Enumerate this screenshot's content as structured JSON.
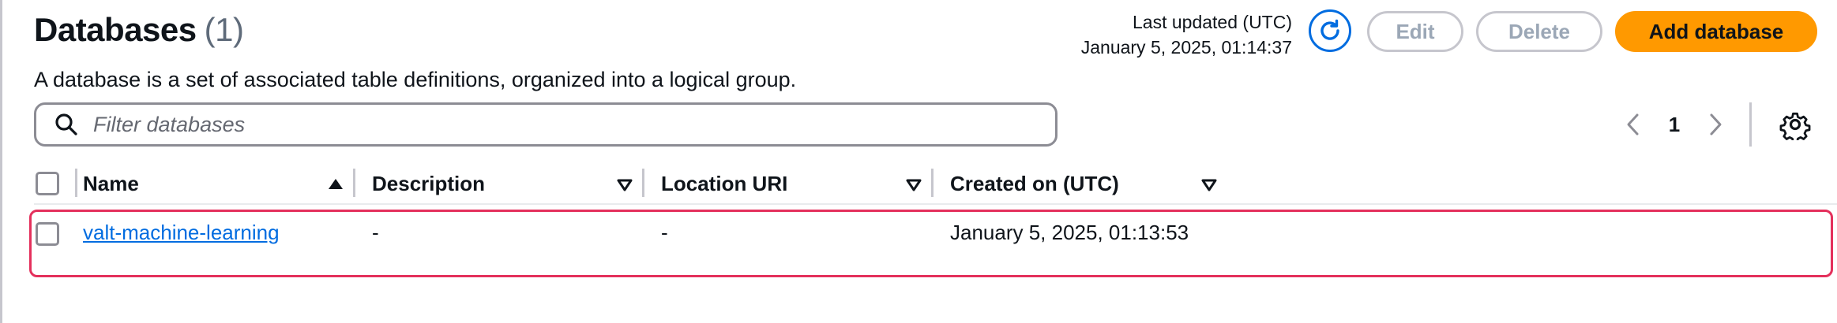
{
  "header": {
    "title": "Databases",
    "count": "(1)",
    "description": "A database is a set of associated table definitions, organized into a logical group.",
    "last_updated_label": "Last updated (UTC)",
    "last_updated_value": "January 5, 2025, 01:14:37",
    "buttons": {
      "refresh_icon": "refresh-icon",
      "edit": "Edit",
      "delete": "Delete",
      "add": "Add database"
    }
  },
  "filter": {
    "placeholder": "Filter databases",
    "icon": "search-icon"
  },
  "pagination": {
    "current_page": "1",
    "prev_icon": "chevron-left-icon",
    "next_icon": "chevron-right-icon",
    "settings_icon": "gear-icon"
  },
  "table": {
    "columns": [
      {
        "label": "Name",
        "sort": "ascending"
      },
      {
        "label": "Description",
        "sort": "none"
      },
      {
        "label": "Location URI",
        "sort": "none"
      },
      {
        "label": "Created on (UTC)",
        "sort": "none"
      }
    ],
    "rows": [
      {
        "name": "valt-machine-learning",
        "description": "-",
        "location_uri": "-",
        "created_on": "January 5, 2025, 01:13:53",
        "selected": false
      }
    ]
  },
  "colors": {
    "primary": "#ff9900",
    "link": "#006ce0",
    "highlight": "#e4305c",
    "disabled": "#9ba7b6"
  }
}
